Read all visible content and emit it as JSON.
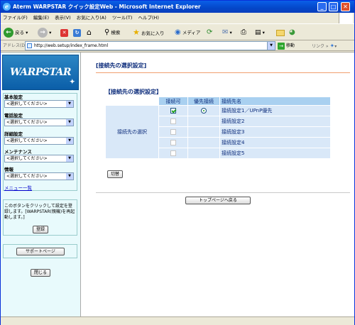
{
  "window": {
    "title": "Aterm WARPSTAR クイック設定Web - Microsoft Internet Explorer"
  },
  "menu": [
    "ファイル(F)",
    "編集(E)",
    "表示(V)",
    "お気に入り(A)",
    "ツール(T)",
    "ヘルプ(H)"
  ],
  "toolbar": {
    "back": "戻る",
    "search": "検索",
    "favorites": "お気に入り",
    "media": "メディア"
  },
  "address": {
    "label": "アドレス(D)",
    "url": "http://web.setup/index_frame.html",
    "go": "移動",
    "links": "リンク"
  },
  "sidebar": {
    "logo": "WARPSTAR",
    "groups": [
      {
        "heading": "基本設定",
        "value": "<選択してください>"
      },
      {
        "heading": "電話設定",
        "value": "<選択してください>"
      },
      {
        "heading": "詳細設定",
        "value": "<選択してください>"
      },
      {
        "heading": "メンテナンス",
        "value": "<選択してください>"
      },
      {
        "heading": "情報",
        "value": "<選択してください>"
      }
    ],
    "menu_list": "メニュー一覧",
    "note": "このボタンをクリックして設定を登録します。[WARPSTAR(親機)を再起動します。]",
    "register": "登録",
    "support": "サポートページ",
    "close": "閉じる"
  },
  "main": {
    "page_title": "[接続先の選択設定]",
    "section_title": "【接続先の選択設定】",
    "columns": [
      "接続可",
      "優先接続",
      "接続先名"
    ],
    "row_label": "接続先の選択",
    "rows": [
      {
        "name": "接続設定1／UPnP優先",
        "enabled": true,
        "priority": true
      },
      {
        "name": "接続設定2",
        "enabled": false,
        "priority": false
      },
      {
        "name": "接続設定3",
        "enabled": false,
        "priority": false
      },
      {
        "name": "接続設定4",
        "enabled": false,
        "priority": false
      },
      {
        "name": "接続設定5",
        "enabled": false,
        "priority": false
      }
    ],
    "switch_button": "切替",
    "top_button": "トップページへ戻る"
  }
}
